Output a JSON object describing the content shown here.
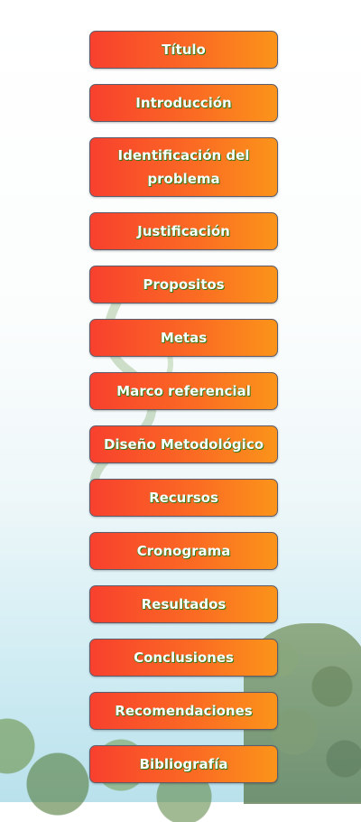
{
  "menu": {
    "items": [
      {
        "label": "Título"
      },
      {
        "label": "Introducción"
      },
      {
        "label": "Identificación del problema"
      },
      {
        "label": "Justificación"
      },
      {
        "label": "Propositos"
      },
      {
        "label": "Metas"
      },
      {
        "label": "Marco referencial"
      },
      {
        "label": "Diseño Metodológico"
      },
      {
        "label": "Recursos"
      },
      {
        "label": "Cronograma"
      },
      {
        "label": "Resultados"
      },
      {
        "label": "Conclusiones"
      },
      {
        "label": "Recomendaciones"
      },
      {
        "label": "Bibliografía"
      }
    ]
  },
  "colors": {
    "button_gradient_start": "#f8402e",
    "button_gradient_end": "#fb941a",
    "label_shadow": "#2f7a16"
  }
}
